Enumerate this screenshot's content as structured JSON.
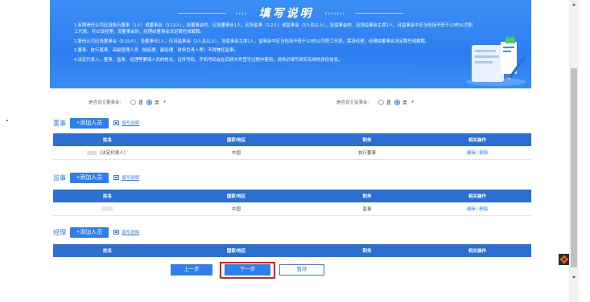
{
  "banner": {
    "arrows_left": "‹‹‹‹",
    "title": "填写说明",
    "arrows_right": "‹‹‹‹‹‹‹",
    "notes": [
      "1.有限责任公司应设执行董事（1人）或董事会（3-13人），设董事会的，应设董事长1人；应设监事（1-2人）或监事会（3人及以上），设监事会的，应设监事会主席1人，且监事会中应当包括不低于1/3的公司职工代表。可以设经理，设董事会的，经理由董事会决定聘任或解聘。",
      "2.股份公司应设董事会（5-19人），设董事长1人；应设监事会（3人及以上），设监事会主席1人，监事会中应当包括不低于1/3的公司职工代表。需设经理，经理由董事会决定聘任或解聘。",
      "3.董事、执行董事、高级管理人员（如经理、副经理、财务负责人等）不得兼任监事。",
      "4.法定代表人、董事、监事、经理等要填人员的姓名、证件号码、手机号码会在后续文件签字过程中使用，请务必填写真实有效的身份信息。"
    ]
  },
  "board_question": {
    "label": "是否设立董事会:",
    "options": [
      "是",
      "否"
    ],
    "selected": "否",
    "required_mark": "•"
  },
  "supervisor_question": {
    "label": "是否设立监事会:",
    "options": [
      "是",
      "否"
    ],
    "selected": "否",
    "required_mark": "•"
  },
  "table_headers": [
    "姓名",
    "国家/地区",
    "职务",
    "相关操作"
  ],
  "sections": [
    {
      "title": "董事",
      "add_label": "+添加人员",
      "help_label": "填写说明",
      "rows": [
        {
          "name_suffix": "（法定代表人）",
          "country": "中国",
          "role": "执行董事",
          "edit": "编辑",
          "sep": "|",
          "delete": "删除"
        }
      ]
    },
    {
      "title": "监事",
      "add_label": "+添加人员",
      "help_label": "填写说明",
      "rows": [
        {
          "name_suffix": "",
          "country": "中国",
          "role": "监事",
          "edit": "编辑",
          "sep": "|",
          "delete": "删除"
        }
      ]
    },
    {
      "title": "经理",
      "add_label": "+添加人员",
      "help_label": "填写说明",
      "rows": []
    }
  ],
  "footer": {
    "prev_label": "上一步",
    "next_label": "下一步",
    "save_label": "暂存"
  },
  "colors": {
    "accent": "#2d7ef0",
    "table_header": "#2a6fd1",
    "banner": "#3b8ff5",
    "highlight": "#e02020",
    "required": "#e4393c"
  },
  "icons": {
    "help": "document-icon",
    "illustration": "clipboard-pen-illustration",
    "widget": "gear-badge-icon"
  }
}
